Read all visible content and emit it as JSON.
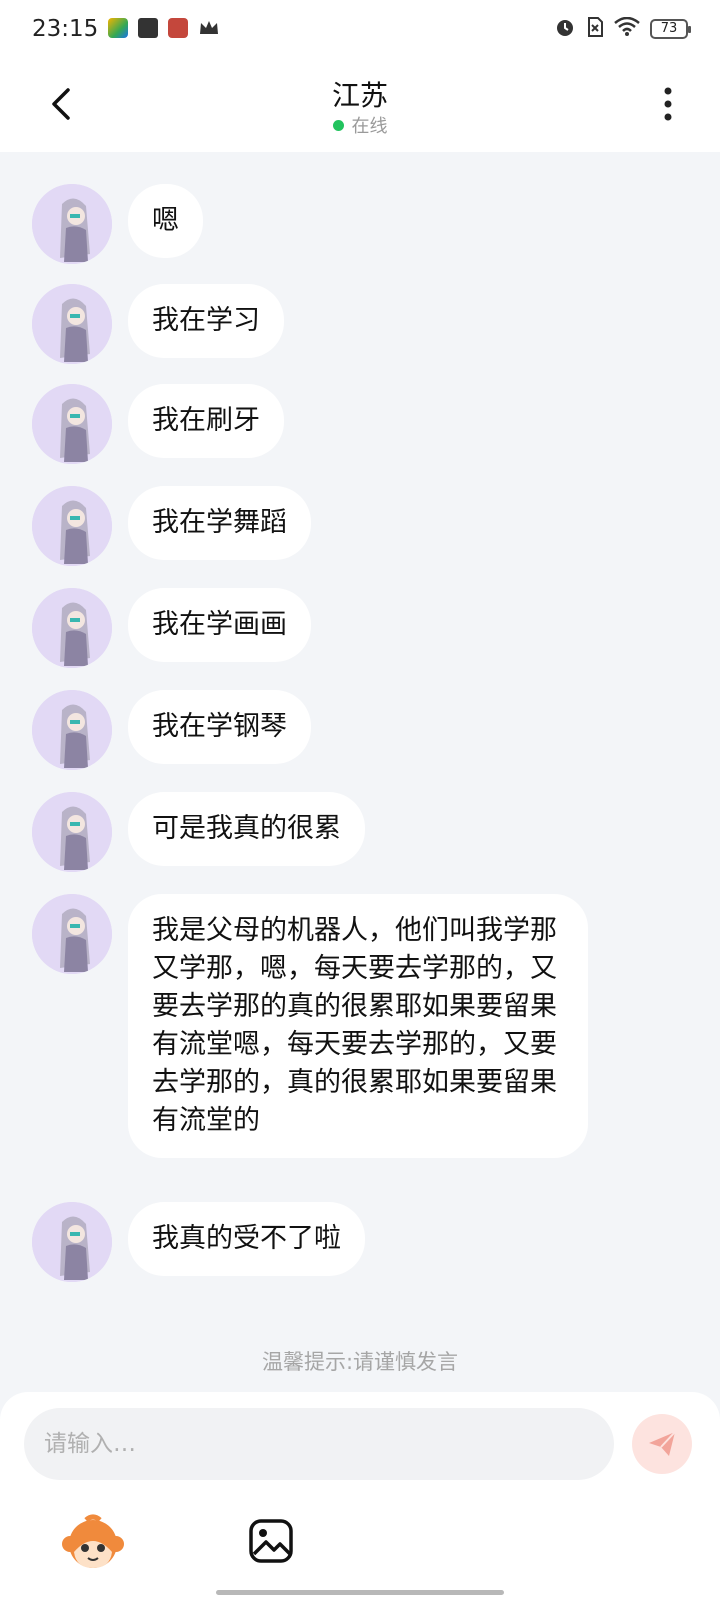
{
  "status_bar": {
    "time": "23:15",
    "battery": "73",
    "left_icons": [
      "video-app-icon",
      "book-icon",
      "calendar-icon",
      "crown-icon"
    ],
    "right_icons": [
      "alarm-icon",
      "no-sim-icon",
      "wifi-icon",
      "battery-icon"
    ]
  },
  "header": {
    "title": "江苏",
    "status": "在线",
    "online_color": "#22c35e"
  },
  "messages": [
    {
      "text": "嗯"
    },
    {
      "text": "我在学习"
    },
    {
      "text": "我在刷牙"
    },
    {
      "text": "我在学舞蹈"
    },
    {
      "text": "我在学画画"
    },
    {
      "text": "我在学钢琴"
    },
    {
      "text": "可是我真的很累"
    },
    {
      "text": "我是父母的机器人，他们叫我学那又学那，嗯，每天要去学那的，又要去学那的真的很累耶如果要留果有流堂嗯，每天要去学那的，又要去学那的，真的很累耶如果要留果有流堂的"
    },
    {
      "text": "我真的受不了啦"
    }
  ],
  "tip": "温馨提示:请谨慎发言",
  "composer": {
    "placeholder": "请输入…",
    "value": "",
    "send_icon": "send-icon",
    "emoji_icon": "monkey-emoji-icon",
    "image_icon": "image-icon",
    "send_bg": "#fde3df",
    "send_fg": "#f2a49a"
  }
}
